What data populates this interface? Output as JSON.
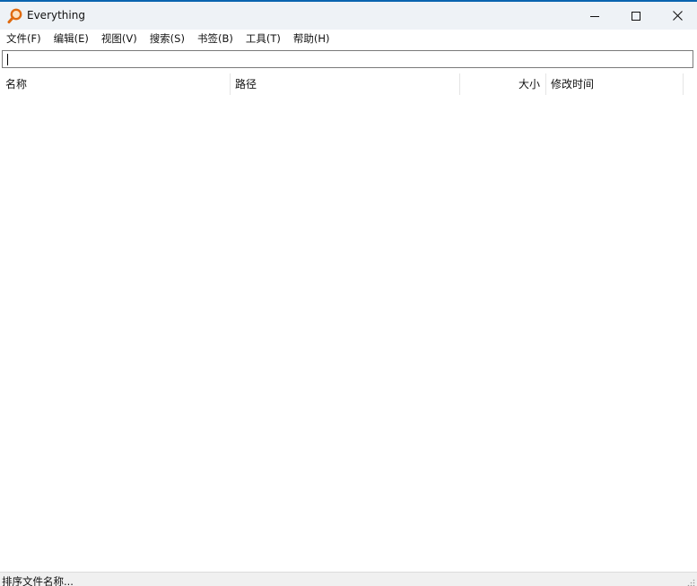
{
  "window": {
    "title": "Everything",
    "controls": {
      "minimize": "minimize",
      "maximize": "maximize",
      "close": "close"
    }
  },
  "menu": {
    "items": [
      {
        "label": "文件(F)"
      },
      {
        "label": "编辑(E)"
      },
      {
        "label": "视图(V)"
      },
      {
        "label": "搜索(S)"
      },
      {
        "label": "书签(B)"
      },
      {
        "label": "工具(T)"
      },
      {
        "label": "帮助(H)"
      }
    ]
  },
  "search": {
    "value": ""
  },
  "columns": {
    "name": "名称",
    "path": "路径",
    "size": "大小",
    "mtime": "修改时间"
  },
  "status": {
    "text": "排序文件名称..."
  },
  "icons": {
    "app": "magnifier-icon",
    "accent": "#e06a0e"
  }
}
